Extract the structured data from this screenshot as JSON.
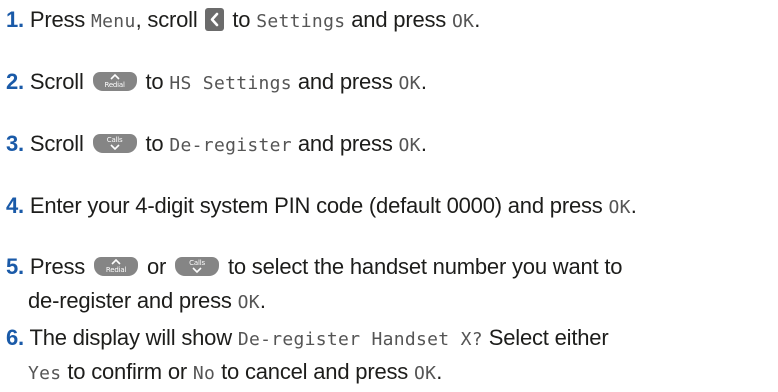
{
  "colors": {
    "number": "#1a5aa8",
    "text": "#1d1d1b",
    "display_text": "#555555",
    "key_bg": "#858585"
  },
  "icons": {
    "left": "chevron-left-key-icon",
    "redial": "redial-up-key-icon",
    "calls": "calls-down-key-icon"
  },
  "keys": {
    "redial_caption": "Redial",
    "calls_caption": "Calls"
  },
  "steps": [
    {
      "number": "1.",
      "t1": "Press ",
      "d1": "Menu",
      "t2": ", scroll ",
      "t3": " to ",
      "d2": "Settings",
      "t4": " and press ",
      "d3": "OK",
      "t5": "."
    },
    {
      "number": "2.",
      "t1": "Scroll ",
      "t2": " to ",
      "d1": "HS Settings",
      "t3": " and press ",
      "d2": "OK",
      "t4": "."
    },
    {
      "number": "3.",
      "t1": "Scroll ",
      "t2": " to ",
      "d1": "De-register",
      "t3": " and press ",
      "d2": "OK",
      "t4": "."
    },
    {
      "number": "4.",
      "t1": "Enter your 4-digit system PIN code (default 0000) and press ",
      "d1": "OK",
      "t2": "."
    },
    {
      "number": "5.",
      "t1": "Press ",
      "t2": " or ",
      "t3": " to select the handset number you want to",
      "t4": "de-register and press ",
      "d1": "OK",
      "t5": "."
    },
    {
      "number": "6.",
      "t1": "The display will show ",
      "d1": "De-register Handset X?",
      "t2": " Select either",
      "d2": "Yes",
      "t3": " to confirm or ",
      "d3": "No",
      "t4": " to cancel and press ",
      "d4": "OK",
      "t5": "."
    }
  ]
}
